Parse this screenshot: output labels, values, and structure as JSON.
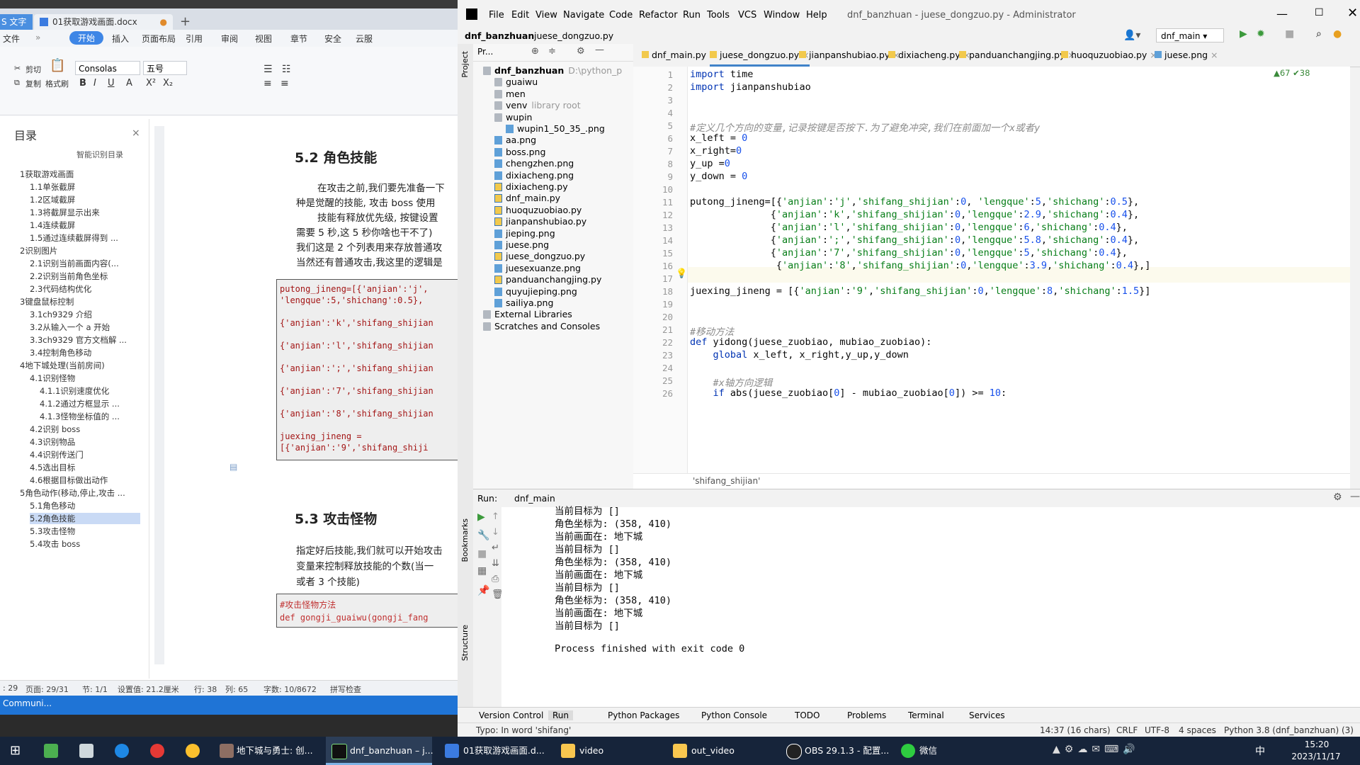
{
  "wps": {
    "tabs": [
      "S 文字",
      "01获取游戏画面.docx"
    ],
    "menu": [
      "文件",
      "开始",
      "插入",
      "页面布局",
      "引用",
      "审阅",
      "视图",
      "章节",
      "安全",
      "云服"
    ],
    "ribbon": {
      "cut": "剪切",
      "copy": "复制",
      "format_painter": "格式刷",
      "font": "Consolas",
      "size": "五号"
    },
    "toc_title": "目录",
    "toc_smart": "智能识别目录",
    "toc": [
      {
        "label": "1获取游戏画面",
        "level": 0
      },
      {
        "label": "1.1单张截屏",
        "level": 1
      },
      {
        "label": "1.2区域截屏",
        "level": 1
      },
      {
        "label": "1.3将截屏显示出来",
        "level": 1
      },
      {
        "label": "1.4连续截屏",
        "level": 1
      },
      {
        "label": "1.5通过连续截屏得到 ...",
        "level": 1
      },
      {
        "label": "2识别图片",
        "level": 0
      },
      {
        "label": "2.1识别当前画面内容(...",
        "level": 1
      },
      {
        "label": "2.2识别当前角色坐标",
        "level": 1
      },
      {
        "label": "2.3代码结构优化",
        "level": 1
      },
      {
        "label": "3键盘鼠标控制",
        "level": 0
      },
      {
        "label": "3.1ch9329 介绍",
        "level": 1
      },
      {
        "label": "3.2从输入一个 a 开始",
        "level": 1
      },
      {
        "label": "3.3ch9329 官方文档解 ...",
        "level": 1
      },
      {
        "label": "3.4控制角色移动",
        "level": 1
      },
      {
        "label": "4地下城处理(当前房间)",
        "level": 0
      },
      {
        "label": "4.1识别怪物",
        "level": 1
      },
      {
        "label": "4.1.1识别速度优化",
        "level": 2
      },
      {
        "label": "4.1.2通过方框显示 ...",
        "level": 2
      },
      {
        "label": "4.1.3怪物坐标值的 ...",
        "level": 2
      },
      {
        "label": "4.2识别 boss",
        "level": 1
      },
      {
        "label": "4.3识别物品",
        "level": 1
      },
      {
        "label": "4.4识别传送门",
        "level": 1
      },
      {
        "label": "4.5选出目标",
        "level": 1
      },
      {
        "label": "4.6根据目标做出动作",
        "level": 1
      },
      {
        "label": "5角色动作(移动,停止,攻击 ...",
        "level": 0
      },
      {
        "label": "5.1角色移动",
        "level": 1
      },
      {
        "label": "5.2角色技能",
        "level": 1
      },
      {
        "label": "5.3攻击怪物",
        "level": 1
      },
      {
        "label": "5.4攻击 boss",
        "level": 1
      }
    ],
    "doc": {
      "h52": "5.2  角色技能",
      "p1": "在攻击之前,我们要先准备一下",
      "p2": "种是觉醒的技能, 攻击 boss 使用",
      "p3": "技能有释放优先级, 按键设置",
      "p4": "需要 5 秒,这 5 秒你啥也干不了)",
      "p5": "我们这是 2 个列表用来存放普通攻",
      "p6": "当然还有普通攻击,我这里的逻辑是",
      "code": [
        "putong_jineng=[{'anjian':'j',",
        "'lengque':5,'shichang':0.5},",
        "",
        "{'anjian':'k','shifang_shijian",
        "",
        "{'anjian':'l','shifang_shijian",
        "",
        "{'anjian':';','shifang_shijian",
        "",
        "{'anjian':'7','shifang_shijian",
        "",
        "{'anjian':'8','shifang_shijian",
        "",
        "juexing_jineng =",
        "[{'anjian':'9','shifang_shiji"
      ],
      "h53": "5.3  攻击怪物",
      "q1": "指定好后技能,我们就可以开始攻击",
      "q2": "变量来控制释放技能的个数(当一",
      "q3": "或者 3 个技能)",
      "code2_1": "#攻击怪物方法",
      "code2_2": "def gongji_guaiwu(gongji_fang"
    },
    "status": {
      "a": ": 29",
      "page": "页面: 29/31",
      "sec": "节: 1/1",
      "set": "设置值: 21.2厘米",
      "row": "行: 38",
      "col": "列: 65",
      "words": "字数: 10/8672",
      "spell": "拼写检查"
    },
    "strip": "Communi..."
  },
  "pycharm": {
    "menu": [
      "File",
      "Edit",
      "View",
      "Navigate",
      "Code",
      "Refactor",
      "Run",
      "Tools",
      "VCS",
      "Window",
      "Help"
    ],
    "title": "dnf_banzhuan - juese_dongzuo.py - Administrator",
    "nav": [
      "dnf_banzhuan",
      "juese_dongzuo.py"
    ],
    "run_config": "dnf_main",
    "project_label": "Pr...",
    "tree": [
      {
        "label": "dnf_banzhuan",
        "extra": "D:\\python_p",
        "indent": 0,
        "icon": "folder"
      },
      {
        "label": "guaiwu",
        "indent": 1,
        "icon": "folder"
      },
      {
        "label": "men",
        "indent": 1,
        "icon": "folder"
      },
      {
        "label": "venv",
        "extra": "library root",
        "indent": 1,
        "icon": "folder"
      },
      {
        "label": "wupin",
        "indent": 1,
        "icon": "folder"
      },
      {
        "label": "wupin1_50_35_.png",
        "indent": 2,
        "icon": "png"
      },
      {
        "label": "aa.png",
        "indent": 1,
        "icon": "png"
      },
      {
        "label": "boss.png",
        "indent": 1,
        "icon": "png"
      },
      {
        "label": "chengzhen.png",
        "indent": 1,
        "icon": "png"
      },
      {
        "label": "dixiacheng.png",
        "indent": 1,
        "icon": "png"
      },
      {
        "label": "dixiacheng.py",
        "indent": 1,
        "icon": "py"
      },
      {
        "label": "dnf_main.py",
        "indent": 1,
        "icon": "py"
      },
      {
        "label": "huoquzuobiao.py",
        "indent": 1,
        "icon": "py"
      },
      {
        "label": "jianpanshubiao.py",
        "indent": 1,
        "icon": "py"
      },
      {
        "label": "jieping.png",
        "indent": 1,
        "icon": "png"
      },
      {
        "label": "juese.png",
        "indent": 1,
        "icon": "png"
      },
      {
        "label": "juese_dongzuo.py",
        "indent": 1,
        "icon": "py"
      },
      {
        "label": "juesexuanze.png",
        "indent": 1,
        "icon": "png"
      },
      {
        "label": "panduanchangjing.py",
        "indent": 1,
        "icon": "py"
      },
      {
        "label": "quyujieping.png",
        "indent": 1,
        "icon": "png"
      },
      {
        "label": "sailiya.png",
        "indent": 1,
        "icon": "png"
      },
      {
        "label": "External Libraries",
        "indent": 0,
        "icon": "folder"
      },
      {
        "label": "Scratches and Consoles",
        "indent": 0,
        "icon": "folder"
      }
    ],
    "tabs": [
      "dnf_main.py",
      "juese_dongzuo.py",
      "jianpanshubiao.py",
      "dixiacheng.py",
      "panduanchangjing.py",
      "huoquzuobiao.py",
      "juese.png"
    ],
    "inspections": "▲67  ✔38",
    "code": [
      {
        "n": "1",
        "html": "<span class='kw'>import</span> time"
      },
      {
        "n": "2",
        "html": "<span class='kw'>import</span> jianpanshubiao"
      },
      {
        "n": "3",
        "html": ""
      },
      {
        "n": "4",
        "html": ""
      },
      {
        "n": "5",
        "html": "<span class='cm'>#定义几个方向的变量,记录按键是否按下.为了避免冲突,我们在前面加一个x或者y</span>"
      },
      {
        "n": "6",
        "html": "x_left = <span class='nm'>0</span>"
      },
      {
        "n": "7",
        "html": "x_right=<span class='nm'>0</span>"
      },
      {
        "n": "8",
        "html": "y_up =<span class='nm'>0</span>"
      },
      {
        "n": "9",
        "html": "y_down = <span class='nm'>0</span>"
      },
      {
        "n": "10",
        "html": ""
      },
      {
        "n": "11",
        "html": "putong_jineng=[{<span class='st'>'anjian'</span>:<span class='st'>'j'</span>,<span class='st'>'shifang_shijian'</span>:<span class='nm'>0</span>, <span class='st'>'lengque'</span>:<span class='nm'>5</span>,<span class='st'>'shichang'</span>:<span class='nm'>0.5</span>},"
      },
      {
        "n": "12",
        "html": "              {<span class='st'>'anjian'</span>:<span class='st'>'k'</span>,<span class='st'>'shifang_shijian'</span>:<span class='nm'>0</span>,<span class='st'>'lengque'</span>:<span class='nm'>2.9</span>,<span class='st'>'shichang'</span>:<span class='nm'>0.4</span>},"
      },
      {
        "n": "13",
        "html": "              {<span class='st'>'anjian'</span>:<span class='st'>'l'</span>,<span class='st'>'shifang_shijian'</span>:<span class='nm'>0</span>,<span class='st'>'lengque'</span>:<span class='nm'>6</span>,<span class='st'>'shichang'</span>:<span class='nm'>0.4</span>},"
      },
      {
        "n": "14",
        "html": "              {<span class='st'>'anjian'</span>:<span class='st'>';'</span>,<span class='st'>'shifang_shijian'</span>:<span class='nm'>0</span>,<span class='st'>'lengque'</span>:<span class='nm'>5.8</span>,<span class='st'>'shichang'</span>:<span class='nm'>0.4</span>},"
      },
      {
        "n": "15",
        "html": "              {<span class='st'>'anjian'</span>:<span class='st'>'7'</span>,<span class='st'>'shifang_shijian'</span>:<span class='nm'>0</span>,<span class='st'>'lengque'</span>:<span class='nm'>5</span>,<span class='st'>'shichang'</span>:<span class='nm'>0.4</span>},"
      },
      {
        "n": "16",
        "html": "               {<span class='st'>'anjian'</span>:<span class='st'>'8'</span>,<span class='st'>'shifang_shijian'</span>:<span class='nm'>0</span>,<span class='st'>'lengque'</span>:<span class='nm'>3.9</span>,<span class='st'>'shichang'</span>:<span class='nm'>0.4</span>},]"
      },
      {
        "n": "17",
        "html": ""
      },
      {
        "n": "18",
        "html": "juexing_jineng = [{<span class='st'>'anjian'</span>:<span class='st'>'9'</span>,<span class='st'>'shifang_shijian'</span>:<span class='nm'>0</span>,<span class='st'>'lengque'</span>:<span class='nm'>8</span>,<span class='st'>'shichang'</span>:<span class='nm'>1.5</span>}]"
      },
      {
        "n": "19",
        "html": ""
      },
      {
        "n": "20",
        "html": ""
      },
      {
        "n": "21",
        "html": "<span class='cm'>#移动方法</span>"
      },
      {
        "n": "22",
        "html": "<span class='kw'>def</span> yidong(juese_zuobiao, mubiao_zuobiao):"
      },
      {
        "n": "23",
        "html": "    <span class='kw'>global</span> x_left, x_right,y_up,y_down"
      },
      {
        "n": "24",
        "html": ""
      },
      {
        "n": "25",
        "html": "    <span class='cm'>#x轴方向逻辑</span>"
      },
      {
        "n": "26",
        "html": "    <span class='kw'>if</span> abs(juese_zuobiao[<span class='nm'>0</span>] - mubiao_zuobiao[<span class='nm'>0</span>]) >= <span class='nm'>10</span>:"
      }
    ],
    "crumb": "'shifang_shijian'",
    "run_label": "Run:",
    "run_tab": "dnf_main",
    "console": [
      "当前目标为 []",
      "角色坐标为: (358, 410)",
      "当前画面在: 地下城",
      "当前目标为 []",
      "角色坐标为: (358, 410)",
      "当前画面在: 地下城",
      "当前目标为 []",
      "角色坐标为: (358, 410)",
      "当前画面在: 地下城",
      "当前目标为 []",
      "",
      "Process finished with exit code 0"
    ],
    "side_labels": [
      "Project",
      "Bookmarks",
      "Structure"
    ],
    "bottom_tabs": [
      "Version Control",
      "Run",
      "Python Packages",
      "Python Console",
      "TODO",
      "Problems",
      "Terminal",
      "Services"
    ],
    "status": {
      "hint": "Typo: In word 'shifang'",
      "pos": "14:37 (16 chars)",
      "crlf": "CRLF",
      "enc": "UTF-8",
      "indent": "4 spaces",
      "interp": "Python 3.8 (dnf_banzhuan) (3)"
    }
  },
  "taskbar": {
    "items": [
      "地下城与勇士: 创...",
      "dnf_banzhuan – j...",
      "01获取游戏画面.d...",
      "video",
      "out_video",
      "OBS 29.1.3 - 配置...",
      "微信"
    ],
    "time": "15:20",
    "date": "2023/11/17",
    "ime": "中"
  }
}
